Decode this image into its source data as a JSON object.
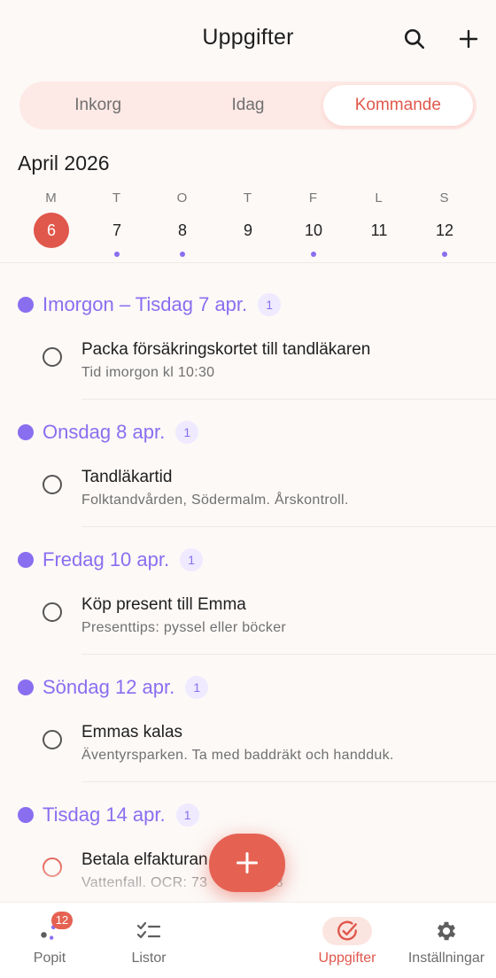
{
  "header": {
    "title": "Uppgifter",
    "search_icon": "search-icon",
    "add_icon": "plus-icon"
  },
  "segments": [
    {
      "label": "Inkorg",
      "active": false
    },
    {
      "label": "Idag",
      "active": false
    },
    {
      "label": "Kommande",
      "active": true
    }
  ],
  "calendar": {
    "month": "April 2026",
    "days": [
      {
        "dow": "M",
        "num": "6",
        "today": true,
        "dot": false
      },
      {
        "dow": "T",
        "num": "7",
        "today": false,
        "dot": true
      },
      {
        "dow": "O",
        "num": "8",
        "today": false,
        "dot": true
      },
      {
        "dow": "T",
        "num": "9",
        "today": false,
        "dot": false
      },
      {
        "dow": "F",
        "num": "10",
        "today": false,
        "dot": true
      },
      {
        "dow": "L",
        "num": "11",
        "today": false,
        "dot": false
      },
      {
        "dow": "S",
        "num": "12",
        "today": false,
        "dot": true
      }
    ]
  },
  "groups": [
    {
      "label": "Imorgon – Tisdag 7 apr.",
      "count": "1",
      "task": {
        "title": "Packa försäkringskortet till tandläkaren",
        "subtitle": "Tid imorgon kl 10:30",
        "flagged": false
      }
    },
    {
      "label": "Onsdag 8 apr.",
      "count": "1",
      "task": {
        "title": "Tandläkartid",
        "subtitle": "Folktandvården, Södermalm. Årskontroll.",
        "flagged": false
      }
    },
    {
      "label": "Fredag 10 apr.",
      "count": "1",
      "task": {
        "title": "Köp present till Emma",
        "subtitle": "Presenttips: pyssel eller böcker",
        "flagged": false
      }
    },
    {
      "label": "Söndag 12 apr.",
      "count": "1",
      "task": {
        "title": "Emmas kalas",
        "subtitle": "Äventyrsparken. Ta med baddräkt och handduk.",
        "flagged": false
      }
    },
    {
      "label": "Tisdag 14 apr.",
      "count": "1",
      "task": {
        "title": "Betala elfakturan",
        "subtitle": "Vattenfall. OCR: 73",
        "subtitle_tail": "823",
        "flagged": true
      }
    }
  ],
  "fab": {
    "icon": "plus-icon"
  },
  "tabs": [
    {
      "label": "Popit",
      "icon": "popit-icon",
      "badge": "12",
      "active": false
    },
    {
      "label": "Listor",
      "icon": "checklist-icon",
      "active": false
    },
    {
      "label": "Uppgifter",
      "icon": "check-circle-icon",
      "active": true
    },
    {
      "label": "Inställningar",
      "icon": "gear-icon",
      "active": false
    }
  ],
  "colors": {
    "accent": "#e0574b",
    "purple": "#8a6ef0",
    "background": "#fcf9f7"
  }
}
